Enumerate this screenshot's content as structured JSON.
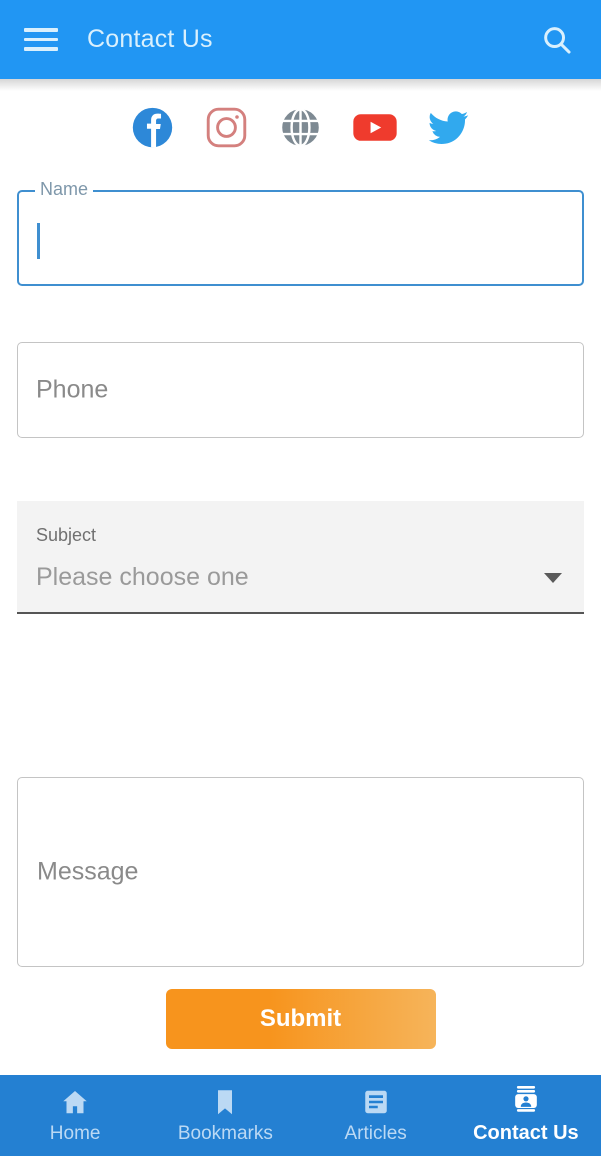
{
  "appbar": {
    "title": "Contact Us",
    "menu_icon": "hamburger-menu-icon",
    "search_icon": "search-icon",
    "background_color": "#2196f3",
    "text_color": "#d9f0fd"
  },
  "social": {
    "items": [
      {
        "name": "facebook",
        "icon": "facebook-icon",
        "color": "#2d88d8"
      },
      {
        "name": "instagram",
        "icon": "instagram-icon",
        "color": "#d4807e"
      },
      {
        "name": "website",
        "icon": "globe-icon",
        "color": "#7e8a93"
      },
      {
        "name": "youtube",
        "icon": "youtube-icon",
        "color": "#ef3b2d"
      },
      {
        "name": "twitter",
        "icon": "twitter-icon",
        "color": "#31a9ee"
      }
    ]
  },
  "form": {
    "name": {
      "label": "Name",
      "value": "",
      "placeholder": "",
      "focused": true,
      "focus_color": "#3f8fd0"
    },
    "phone": {
      "label": "",
      "placeholder": "Phone",
      "value": ""
    },
    "subject": {
      "label": "Subject",
      "selected": "Please choose one",
      "arrow_icon": "chevron-down-icon"
    },
    "message": {
      "placeholder": "Message",
      "value": ""
    },
    "submit": {
      "label": "Submit",
      "color_start": "#f7941d",
      "color_end": "#f6b45a"
    }
  },
  "bottomnav": {
    "background_color": "#2480d2",
    "items": [
      {
        "label": "Home",
        "icon": "home-icon",
        "active": false
      },
      {
        "label": "Bookmarks",
        "icon": "bookmark-icon",
        "active": false
      },
      {
        "label": "Articles",
        "icon": "article-icon",
        "active": false
      },
      {
        "label": "Contact Us",
        "icon": "contact-card-icon",
        "active": true
      }
    ]
  }
}
